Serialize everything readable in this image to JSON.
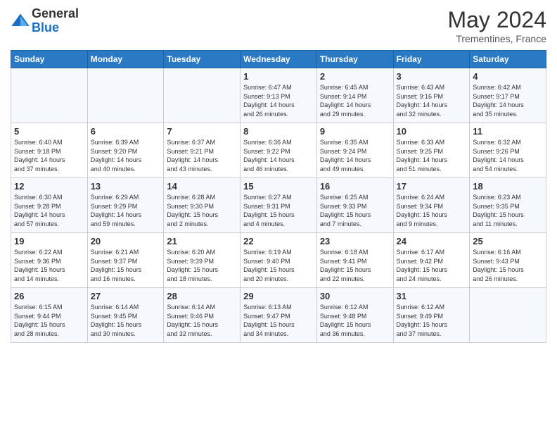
{
  "header": {
    "logo_general": "General",
    "logo_blue": "Blue",
    "month_title": "May 2024",
    "location": "Trementines, France"
  },
  "days_of_week": [
    "Sunday",
    "Monday",
    "Tuesday",
    "Wednesday",
    "Thursday",
    "Friday",
    "Saturday"
  ],
  "weeks": [
    [
      {
        "day": "",
        "info": ""
      },
      {
        "day": "",
        "info": ""
      },
      {
        "day": "",
        "info": ""
      },
      {
        "day": "1",
        "info": "Sunrise: 6:47 AM\nSunset: 9:13 PM\nDaylight: 14 hours\nand 26 minutes."
      },
      {
        "day": "2",
        "info": "Sunrise: 6:45 AM\nSunset: 9:14 PM\nDaylight: 14 hours\nand 29 minutes."
      },
      {
        "day": "3",
        "info": "Sunrise: 6:43 AM\nSunset: 9:16 PM\nDaylight: 14 hours\nand 32 minutes."
      },
      {
        "day": "4",
        "info": "Sunrise: 6:42 AM\nSunset: 9:17 PM\nDaylight: 14 hours\nand 35 minutes."
      }
    ],
    [
      {
        "day": "5",
        "info": "Sunrise: 6:40 AM\nSunset: 9:18 PM\nDaylight: 14 hours\nand 37 minutes."
      },
      {
        "day": "6",
        "info": "Sunrise: 6:39 AM\nSunset: 9:20 PM\nDaylight: 14 hours\nand 40 minutes."
      },
      {
        "day": "7",
        "info": "Sunrise: 6:37 AM\nSunset: 9:21 PM\nDaylight: 14 hours\nand 43 minutes."
      },
      {
        "day": "8",
        "info": "Sunrise: 6:36 AM\nSunset: 9:22 PM\nDaylight: 14 hours\nand 46 minutes."
      },
      {
        "day": "9",
        "info": "Sunrise: 6:35 AM\nSunset: 9:24 PM\nDaylight: 14 hours\nand 49 minutes."
      },
      {
        "day": "10",
        "info": "Sunrise: 6:33 AM\nSunset: 9:25 PM\nDaylight: 14 hours\nand 51 minutes."
      },
      {
        "day": "11",
        "info": "Sunrise: 6:32 AM\nSunset: 9:26 PM\nDaylight: 14 hours\nand 54 minutes."
      }
    ],
    [
      {
        "day": "12",
        "info": "Sunrise: 6:30 AM\nSunset: 9:28 PM\nDaylight: 14 hours\nand 57 minutes."
      },
      {
        "day": "13",
        "info": "Sunrise: 6:29 AM\nSunset: 9:29 PM\nDaylight: 14 hours\nand 59 minutes."
      },
      {
        "day": "14",
        "info": "Sunrise: 6:28 AM\nSunset: 9:30 PM\nDaylight: 15 hours\nand 2 minutes."
      },
      {
        "day": "15",
        "info": "Sunrise: 6:27 AM\nSunset: 9:31 PM\nDaylight: 15 hours\nand 4 minutes."
      },
      {
        "day": "16",
        "info": "Sunrise: 6:25 AM\nSunset: 9:33 PM\nDaylight: 15 hours\nand 7 minutes."
      },
      {
        "day": "17",
        "info": "Sunrise: 6:24 AM\nSunset: 9:34 PM\nDaylight: 15 hours\nand 9 minutes."
      },
      {
        "day": "18",
        "info": "Sunrise: 6:23 AM\nSunset: 9:35 PM\nDaylight: 15 hours\nand 11 minutes."
      }
    ],
    [
      {
        "day": "19",
        "info": "Sunrise: 6:22 AM\nSunset: 9:36 PM\nDaylight: 15 hours\nand 14 minutes."
      },
      {
        "day": "20",
        "info": "Sunrise: 6:21 AM\nSunset: 9:37 PM\nDaylight: 15 hours\nand 16 minutes."
      },
      {
        "day": "21",
        "info": "Sunrise: 6:20 AM\nSunset: 9:39 PM\nDaylight: 15 hours\nand 18 minutes."
      },
      {
        "day": "22",
        "info": "Sunrise: 6:19 AM\nSunset: 9:40 PM\nDaylight: 15 hours\nand 20 minutes."
      },
      {
        "day": "23",
        "info": "Sunrise: 6:18 AM\nSunset: 9:41 PM\nDaylight: 15 hours\nand 22 minutes."
      },
      {
        "day": "24",
        "info": "Sunrise: 6:17 AM\nSunset: 9:42 PM\nDaylight: 15 hours\nand 24 minutes."
      },
      {
        "day": "25",
        "info": "Sunrise: 6:16 AM\nSunset: 9:43 PM\nDaylight: 15 hours\nand 26 minutes."
      }
    ],
    [
      {
        "day": "26",
        "info": "Sunrise: 6:15 AM\nSunset: 9:44 PM\nDaylight: 15 hours\nand 28 minutes."
      },
      {
        "day": "27",
        "info": "Sunrise: 6:14 AM\nSunset: 9:45 PM\nDaylight: 15 hours\nand 30 minutes."
      },
      {
        "day": "28",
        "info": "Sunrise: 6:14 AM\nSunset: 9:46 PM\nDaylight: 15 hours\nand 32 minutes."
      },
      {
        "day": "29",
        "info": "Sunrise: 6:13 AM\nSunset: 9:47 PM\nDaylight: 15 hours\nand 34 minutes."
      },
      {
        "day": "30",
        "info": "Sunrise: 6:12 AM\nSunset: 9:48 PM\nDaylight: 15 hours\nand 36 minutes."
      },
      {
        "day": "31",
        "info": "Sunrise: 6:12 AM\nSunset: 9:49 PM\nDaylight: 15 hours\nand 37 minutes."
      },
      {
        "day": "",
        "info": ""
      }
    ]
  ]
}
